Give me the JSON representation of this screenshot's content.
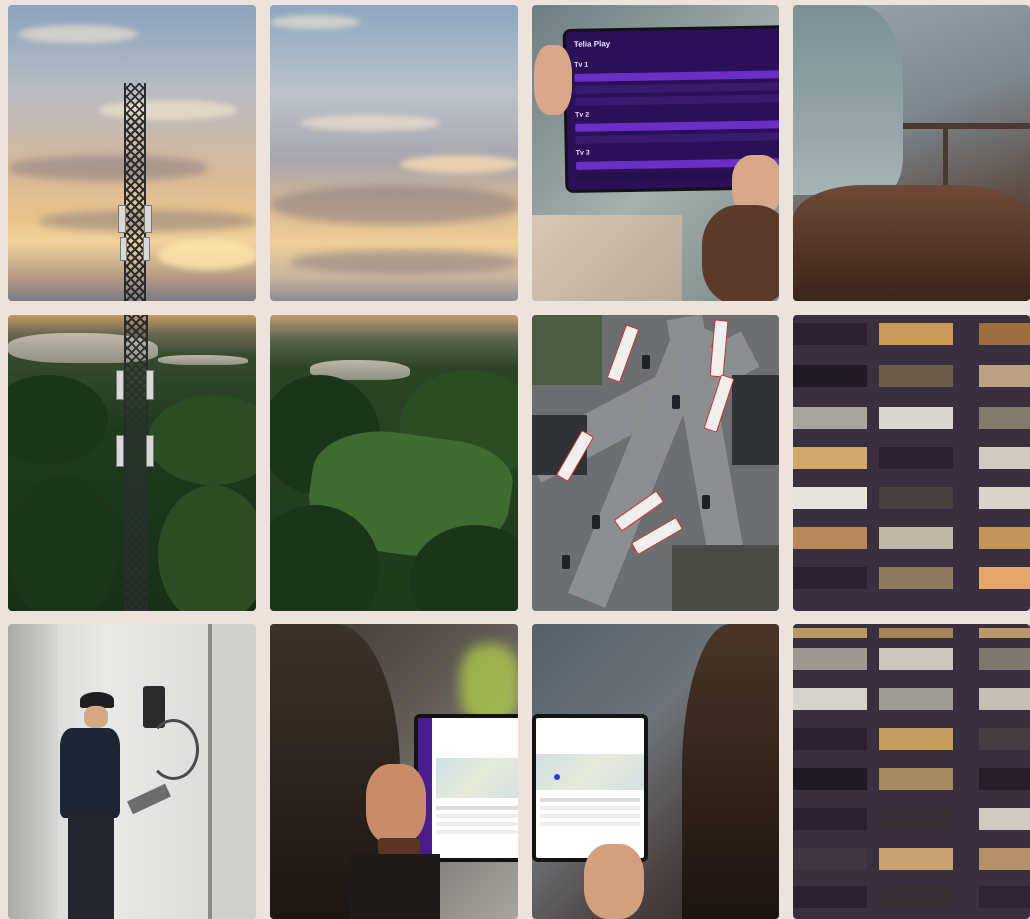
{
  "tablet_app": {
    "brand": "Telia Play",
    "sections": [
      "Tv 1",
      "Tv 2",
      "Tv 3"
    ]
  },
  "colors": {
    "background": "#ede3dc",
    "brand_purple": "#6b2fc7"
  }
}
